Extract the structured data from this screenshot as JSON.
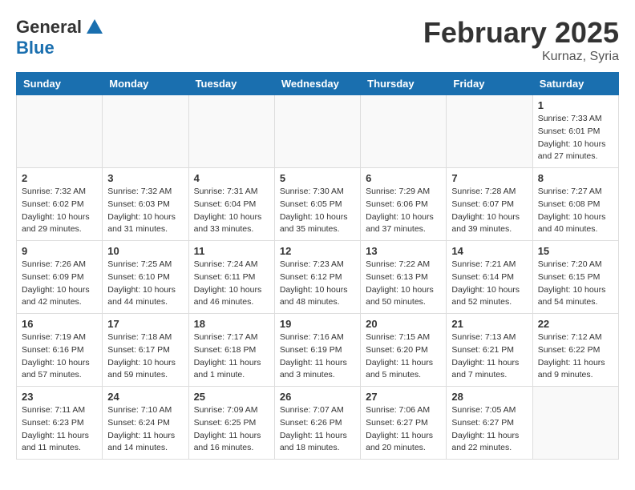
{
  "header": {
    "logo_general": "General",
    "logo_blue": "Blue",
    "month_year": "February 2025",
    "location": "Kurnaz, Syria"
  },
  "weekdays": [
    "Sunday",
    "Monday",
    "Tuesday",
    "Wednesday",
    "Thursday",
    "Friday",
    "Saturday"
  ],
  "weeks": [
    [
      {
        "day": "",
        "info": ""
      },
      {
        "day": "",
        "info": ""
      },
      {
        "day": "",
        "info": ""
      },
      {
        "day": "",
        "info": ""
      },
      {
        "day": "",
        "info": ""
      },
      {
        "day": "",
        "info": ""
      },
      {
        "day": "1",
        "info": "Sunrise: 7:33 AM\nSunset: 6:01 PM\nDaylight: 10 hours\nand 27 minutes."
      }
    ],
    [
      {
        "day": "2",
        "info": "Sunrise: 7:32 AM\nSunset: 6:02 PM\nDaylight: 10 hours\nand 29 minutes."
      },
      {
        "day": "3",
        "info": "Sunrise: 7:32 AM\nSunset: 6:03 PM\nDaylight: 10 hours\nand 31 minutes."
      },
      {
        "day": "4",
        "info": "Sunrise: 7:31 AM\nSunset: 6:04 PM\nDaylight: 10 hours\nand 33 minutes."
      },
      {
        "day": "5",
        "info": "Sunrise: 7:30 AM\nSunset: 6:05 PM\nDaylight: 10 hours\nand 35 minutes."
      },
      {
        "day": "6",
        "info": "Sunrise: 7:29 AM\nSunset: 6:06 PM\nDaylight: 10 hours\nand 37 minutes."
      },
      {
        "day": "7",
        "info": "Sunrise: 7:28 AM\nSunset: 6:07 PM\nDaylight: 10 hours\nand 39 minutes."
      },
      {
        "day": "8",
        "info": "Sunrise: 7:27 AM\nSunset: 6:08 PM\nDaylight: 10 hours\nand 40 minutes."
      }
    ],
    [
      {
        "day": "9",
        "info": "Sunrise: 7:26 AM\nSunset: 6:09 PM\nDaylight: 10 hours\nand 42 minutes."
      },
      {
        "day": "10",
        "info": "Sunrise: 7:25 AM\nSunset: 6:10 PM\nDaylight: 10 hours\nand 44 minutes."
      },
      {
        "day": "11",
        "info": "Sunrise: 7:24 AM\nSunset: 6:11 PM\nDaylight: 10 hours\nand 46 minutes."
      },
      {
        "day": "12",
        "info": "Sunrise: 7:23 AM\nSunset: 6:12 PM\nDaylight: 10 hours\nand 48 minutes."
      },
      {
        "day": "13",
        "info": "Sunrise: 7:22 AM\nSunset: 6:13 PM\nDaylight: 10 hours\nand 50 minutes."
      },
      {
        "day": "14",
        "info": "Sunrise: 7:21 AM\nSunset: 6:14 PM\nDaylight: 10 hours\nand 52 minutes."
      },
      {
        "day": "15",
        "info": "Sunrise: 7:20 AM\nSunset: 6:15 PM\nDaylight: 10 hours\nand 54 minutes."
      }
    ],
    [
      {
        "day": "16",
        "info": "Sunrise: 7:19 AM\nSunset: 6:16 PM\nDaylight: 10 hours\nand 57 minutes."
      },
      {
        "day": "17",
        "info": "Sunrise: 7:18 AM\nSunset: 6:17 PM\nDaylight: 10 hours\nand 59 minutes."
      },
      {
        "day": "18",
        "info": "Sunrise: 7:17 AM\nSunset: 6:18 PM\nDaylight: 11 hours\nand 1 minute."
      },
      {
        "day": "19",
        "info": "Sunrise: 7:16 AM\nSunset: 6:19 PM\nDaylight: 11 hours\nand 3 minutes."
      },
      {
        "day": "20",
        "info": "Sunrise: 7:15 AM\nSunset: 6:20 PM\nDaylight: 11 hours\nand 5 minutes."
      },
      {
        "day": "21",
        "info": "Sunrise: 7:13 AM\nSunset: 6:21 PM\nDaylight: 11 hours\nand 7 minutes."
      },
      {
        "day": "22",
        "info": "Sunrise: 7:12 AM\nSunset: 6:22 PM\nDaylight: 11 hours\nand 9 minutes."
      }
    ],
    [
      {
        "day": "23",
        "info": "Sunrise: 7:11 AM\nSunset: 6:23 PM\nDaylight: 11 hours\nand 11 minutes."
      },
      {
        "day": "24",
        "info": "Sunrise: 7:10 AM\nSunset: 6:24 PM\nDaylight: 11 hours\nand 14 minutes."
      },
      {
        "day": "25",
        "info": "Sunrise: 7:09 AM\nSunset: 6:25 PM\nDaylight: 11 hours\nand 16 minutes."
      },
      {
        "day": "26",
        "info": "Sunrise: 7:07 AM\nSunset: 6:26 PM\nDaylight: 11 hours\nand 18 minutes."
      },
      {
        "day": "27",
        "info": "Sunrise: 7:06 AM\nSunset: 6:27 PM\nDaylight: 11 hours\nand 20 minutes."
      },
      {
        "day": "28",
        "info": "Sunrise: 7:05 AM\nSunset: 6:27 PM\nDaylight: 11 hours\nand 22 minutes."
      },
      {
        "day": "",
        "info": ""
      }
    ]
  ]
}
